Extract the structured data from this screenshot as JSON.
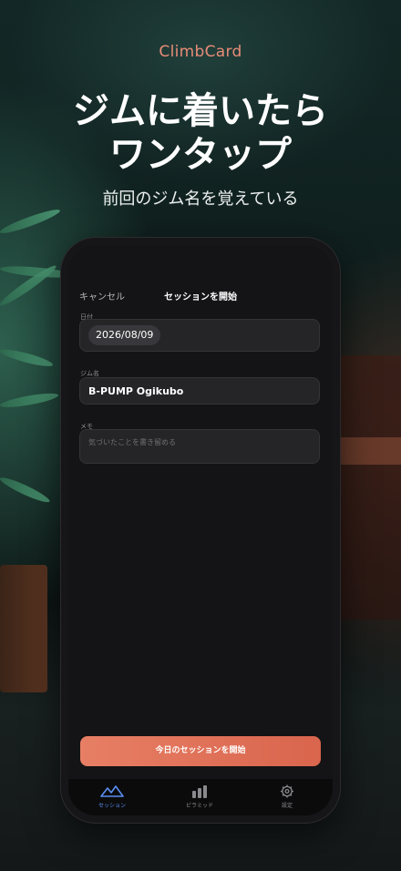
{
  "promo": {
    "app_name": "ClimbCard",
    "headline_line1": "ジムに着いたら",
    "headline_line2": "ワンタップ",
    "subtitle": "前回のジム名を覚えている"
  },
  "form": {
    "cancel_label": "キャンセル",
    "title": "セッションを開始",
    "date_label": "日付",
    "date_value": "2026/08/09",
    "gym_label": "ジム名",
    "gym_value": "B-PUMP Ogikubo",
    "memo_label": "メモ",
    "memo_placeholder": "気づいたことを書き留める",
    "start_button_label": "今日のセッションを開始"
  },
  "tabbar": {
    "items": [
      {
        "label": "セッション",
        "icon": "mountain-icon",
        "active": true
      },
      {
        "label": "ピラミッド",
        "icon": "bar-chart-icon",
        "active": false
      },
      {
        "label": "設定",
        "icon": "gear-icon",
        "active": false
      }
    ]
  },
  "colors": {
    "accent": "#e77f65",
    "active_tab": "#5b8ef0",
    "screen_bg": "#141315"
  }
}
